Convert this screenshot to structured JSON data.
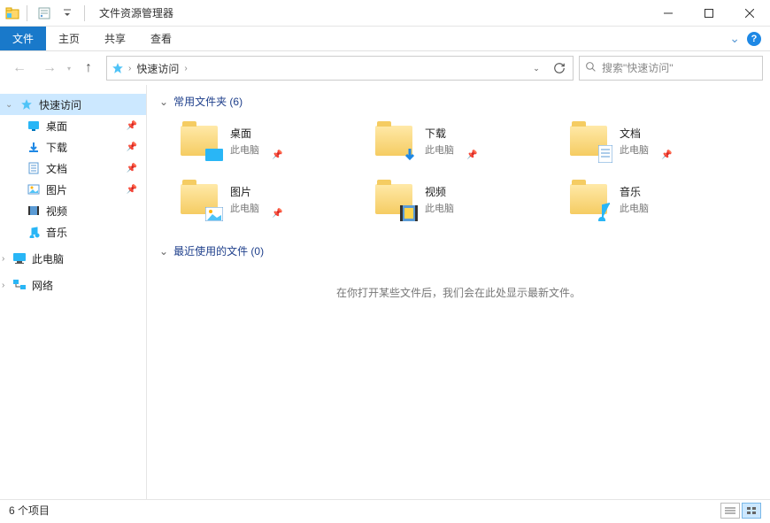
{
  "titlebar": {
    "app_title": "文件资源管理器"
  },
  "ribbon": {
    "file": "文件",
    "home": "主页",
    "share": "共享",
    "view": "查看"
  },
  "nav": {
    "crumb": "快速访问",
    "search_placeholder": "搜索\"快速访问\""
  },
  "sidebar": {
    "quick_access": "快速访问",
    "desktop": "桌面",
    "downloads": "下载",
    "documents": "文档",
    "pictures": "图片",
    "videos": "视频",
    "music": "音乐",
    "this_pc": "此电脑",
    "network": "网络"
  },
  "content": {
    "frequent_header": "常用文件夹 (6)",
    "recent_header": "最近使用的文件 (0)",
    "empty_recent": "在你打开某些文件后，我们会在此处显示最新文件。",
    "sub_thispc": "此电脑",
    "folders": [
      {
        "name": "桌面"
      },
      {
        "name": "下载"
      },
      {
        "name": "文档"
      },
      {
        "name": "图片"
      },
      {
        "name": "视频"
      },
      {
        "name": "音乐"
      }
    ]
  },
  "statusbar": {
    "count": "6 个项目"
  }
}
